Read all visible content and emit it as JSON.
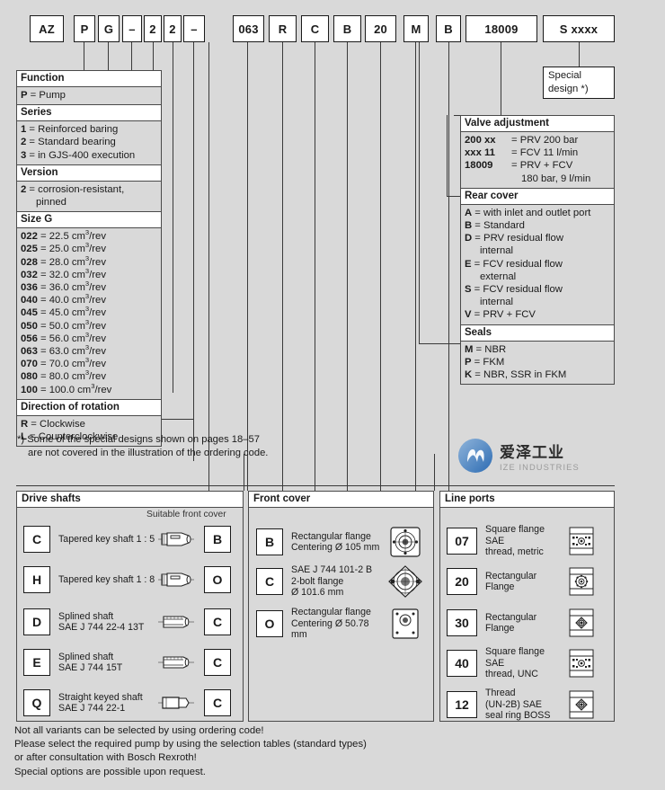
{
  "ordering_code": {
    "left_group": [
      "AZ",
      "P",
      "G",
      "–",
      "2",
      "2",
      "–"
    ],
    "right_group": [
      "063",
      "R",
      "C",
      "B",
      "20",
      "M",
      "B",
      "18009",
      "S xxxx"
    ]
  },
  "left_blocks": {
    "function": {
      "title": "Function",
      "rows": [
        {
          "code": "P",
          "eq": "=",
          "text": "Pump"
        }
      ]
    },
    "series": {
      "title": "Series",
      "rows": [
        {
          "code": "1",
          "eq": "=",
          "text": "Reinforced baring"
        },
        {
          "code": "2",
          "eq": "=",
          "text": "Standard bearing"
        },
        {
          "code": "3",
          "eq": "=",
          "text": "in GJS-400 execution"
        }
      ]
    },
    "version": {
      "title": "Version",
      "rows": [
        {
          "code": "2",
          "eq": "=",
          "text": "corrosion-resistant,"
        }
      ],
      "cont": "pinned"
    },
    "size_g": {
      "title": "Size G",
      "rows": [
        {
          "code": "022",
          "eq": "=",
          "value": "22.5",
          "unit": "cm",
          "sup": "3",
          "per": "/rev"
        },
        {
          "code": "025",
          "eq": "=",
          "value": "25.0",
          "unit": "cm",
          "sup": "3",
          "per": "/rev"
        },
        {
          "code": "028",
          "eq": "=",
          "value": "28.0",
          "unit": "cm",
          "sup": "3",
          "per": "/rev"
        },
        {
          "code": "032",
          "eq": "=",
          "value": "32.0",
          "unit": "cm",
          "sup": "3",
          "per": "/rev"
        },
        {
          "code": "036",
          "eq": "=",
          "value": "36.0",
          "unit": "cm",
          "sup": "3",
          "per": "/rev"
        },
        {
          "code": "040",
          "eq": "=",
          "value": "40.0",
          "unit": "cm",
          "sup": "3",
          "per": "/rev"
        },
        {
          "code": "045",
          "eq": "=",
          "value": "45.0",
          "unit": "cm",
          "sup": "3",
          "per": "/rev"
        },
        {
          "code": "050",
          "eq": "=",
          "value": "50.0",
          "unit": "cm",
          "sup": "3",
          "per": "/rev"
        },
        {
          "code": "056",
          "eq": "=",
          "value": "56.0",
          "unit": "cm",
          "sup": "3",
          "per": "/rev"
        },
        {
          "code": "063",
          "eq": "=",
          "value": "63.0",
          "unit": "cm",
          "sup": "3",
          "per": "/rev"
        },
        {
          "code": "070",
          "eq": "=",
          "value": "70.0",
          "unit": "cm",
          "sup": "3",
          "per": "/rev"
        },
        {
          "code": "080",
          "eq": "=",
          "value": "80.0",
          "unit": "cm",
          "sup": "3",
          "per": "/rev"
        },
        {
          "code": "100",
          "eq": "=",
          "value": "100.0",
          "unit": "cm",
          "sup": "3",
          "per": "/rev"
        }
      ]
    },
    "rotation": {
      "title": "Direction of rotation",
      "rows": [
        {
          "code": "R",
          "eq": "=",
          "text": "Clockwise"
        },
        {
          "code": "L",
          "eq": "=",
          "text": "Counterclockwise"
        }
      ]
    }
  },
  "footnote": {
    "line1": "*) Some of the special designs shown on pages 18–57",
    "line2": "are not covered in the illustration of the ordering code."
  },
  "right_blocks": {
    "special_design": {
      "line1": "Special",
      "line2": "design *)"
    },
    "valve_adjustment": {
      "title": "Valve adjustment",
      "rows": [
        {
          "code": "200 xx",
          "eq": "=",
          "text": "PRV 200 bar"
        },
        {
          "code": "xxx 11",
          "eq": "=",
          "text": "FCV 11 l/min"
        },
        {
          "code": "18009",
          "eq": "=",
          "text": "PRV + FCV"
        }
      ],
      "cont": "180 bar, 9 l/min"
    },
    "rear_cover": {
      "title": "Rear cover",
      "rows": [
        {
          "code": "A",
          "eq": "=",
          "text": "with inlet and outlet port"
        },
        {
          "code": "B",
          "eq": "=",
          "text": "Standard"
        },
        {
          "code": "D",
          "eq": "=",
          "text": "PRV residual flow",
          "cont": "internal"
        },
        {
          "code": "E",
          "eq": "=",
          "text": "FCV residual flow",
          "cont": "external"
        },
        {
          "code": "S",
          "eq": "=",
          "text": "FCV residual flow",
          "cont": "internal"
        },
        {
          "code": "V",
          "eq": "=",
          "text": "PRV + FCV"
        }
      ]
    },
    "seals": {
      "title": "Seals",
      "rows": [
        {
          "code": "M",
          "eq": "=",
          "text": "NBR"
        },
        {
          "code": "P",
          "eq": "=",
          "text": "FKM"
        },
        {
          "code": "K",
          "eq": "=",
          "text": "NBR, SSR in FKM"
        }
      ]
    }
  },
  "bottom": {
    "drive_shafts": {
      "title": "Drive shafts",
      "suitable_label": "Suitable front cover",
      "rows": [
        {
          "key": "C",
          "line1": "Tapered key shaft 1 : 5",
          "line2": "",
          "icon": "tapered-shaft-icon",
          "cover": "B"
        },
        {
          "key": "H",
          "line1": "Tapered key shaft 1 : 8",
          "line2": "",
          "icon": "tapered-shaft-icon",
          "cover": "O"
        },
        {
          "key": "D",
          "line1": "Splined shaft",
          "line2": "SAE J 744 22-4 13T",
          "icon": "splined-shaft-icon",
          "cover": "C"
        },
        {
          "key": "E",
          "line1": "Splined shaft",
          "line2": "SAE J 744 15T",
          "icon": "splined-shaft-icon",
          "cover": "C"
        },
        {
          "key": "Q",
          "line1": "Straight keyed shaft",
          "line2": "SAE J 744 22-1",
          "icon": "keyed-shaft-icon",
          "cover": "C"
        }
      ]
    },
    "front_cover": {
      "title": "Front cover",
      "rows": [
        {
          "key": "B",
          "line1": "Rectangular flange",
          "line2": "Centering Ø 105 mm",
          "line3": "",
          "icon": "rect-flange-icon"
        },
        {
          "key": "C",
          "line1": "SAE J 744 101-2 B",
          "line2": "2-bolt flange",
          "line3": "Ø 101.6 mm",
          "icon": "sae-2bolt-flange-icon"
        },
        {
          "key": "O",
          "line1": "Rectangular flange",
          "line2": "Centering Ø 50.78 mm",
          "line3": "",
          "icon": "rect-flange-small-icon"
        }
      ]
    },
    "line_ports": {
      "title": "Line ports",
      "rows": [
        {
          "key": "07",
          "line1": "Square flange SAE",
          "line2": "thread, metric",
          "line3": "",
          "icon": "square-flange-metric-icon"
        },
        {
          "key": "20",
          "line1": "Rectangular",
          "line2": "Flange",
          "line3": "",
          "icon": "rect-flange-port-icon"
        },
        {
          "key": "30",
          "line1": "Rectangular",
          "line2": "Flange",
          "line3": "",
          "icon": "rect-flange-port2-icon"
        },
        {
          "key": "40",
          "line1": "Square flange SAE",
          "line2": "thread, UNC",
          "line3": "",
          "icon": "square-flange-unc-icon"
        },
        {
          "key": "12",
          "line1": "Thread",
          "line2": "(UN-2B) SAE",
          "line3": "seal ring BOSS",
          "icon": "thread-boss-icon"
        }
      ]
    }
  },
  "footer": {
    "line1": "Not all variants can be selected by using ordering code!",
    "line2": "Please select the required pump by using the selection tables (standard types)",
    "line3": "or after consultation with Bosch Rexroth!",
    "line4": "Special options are possible upon request."
  },
  "logo": {
    "cn": "爱泽工业",
    "en": "IZE INDUSTRIES",
    "color_from": "#7fa9d4",
    "color_to": "#2f6fb5"
  },
  "colors": {
    "page_bg": "#d9d9d9",
    "box_bg": "#ffffff",
    "line": "#3a3a3a",
    "text": "#1a1a1a"
  }
}
